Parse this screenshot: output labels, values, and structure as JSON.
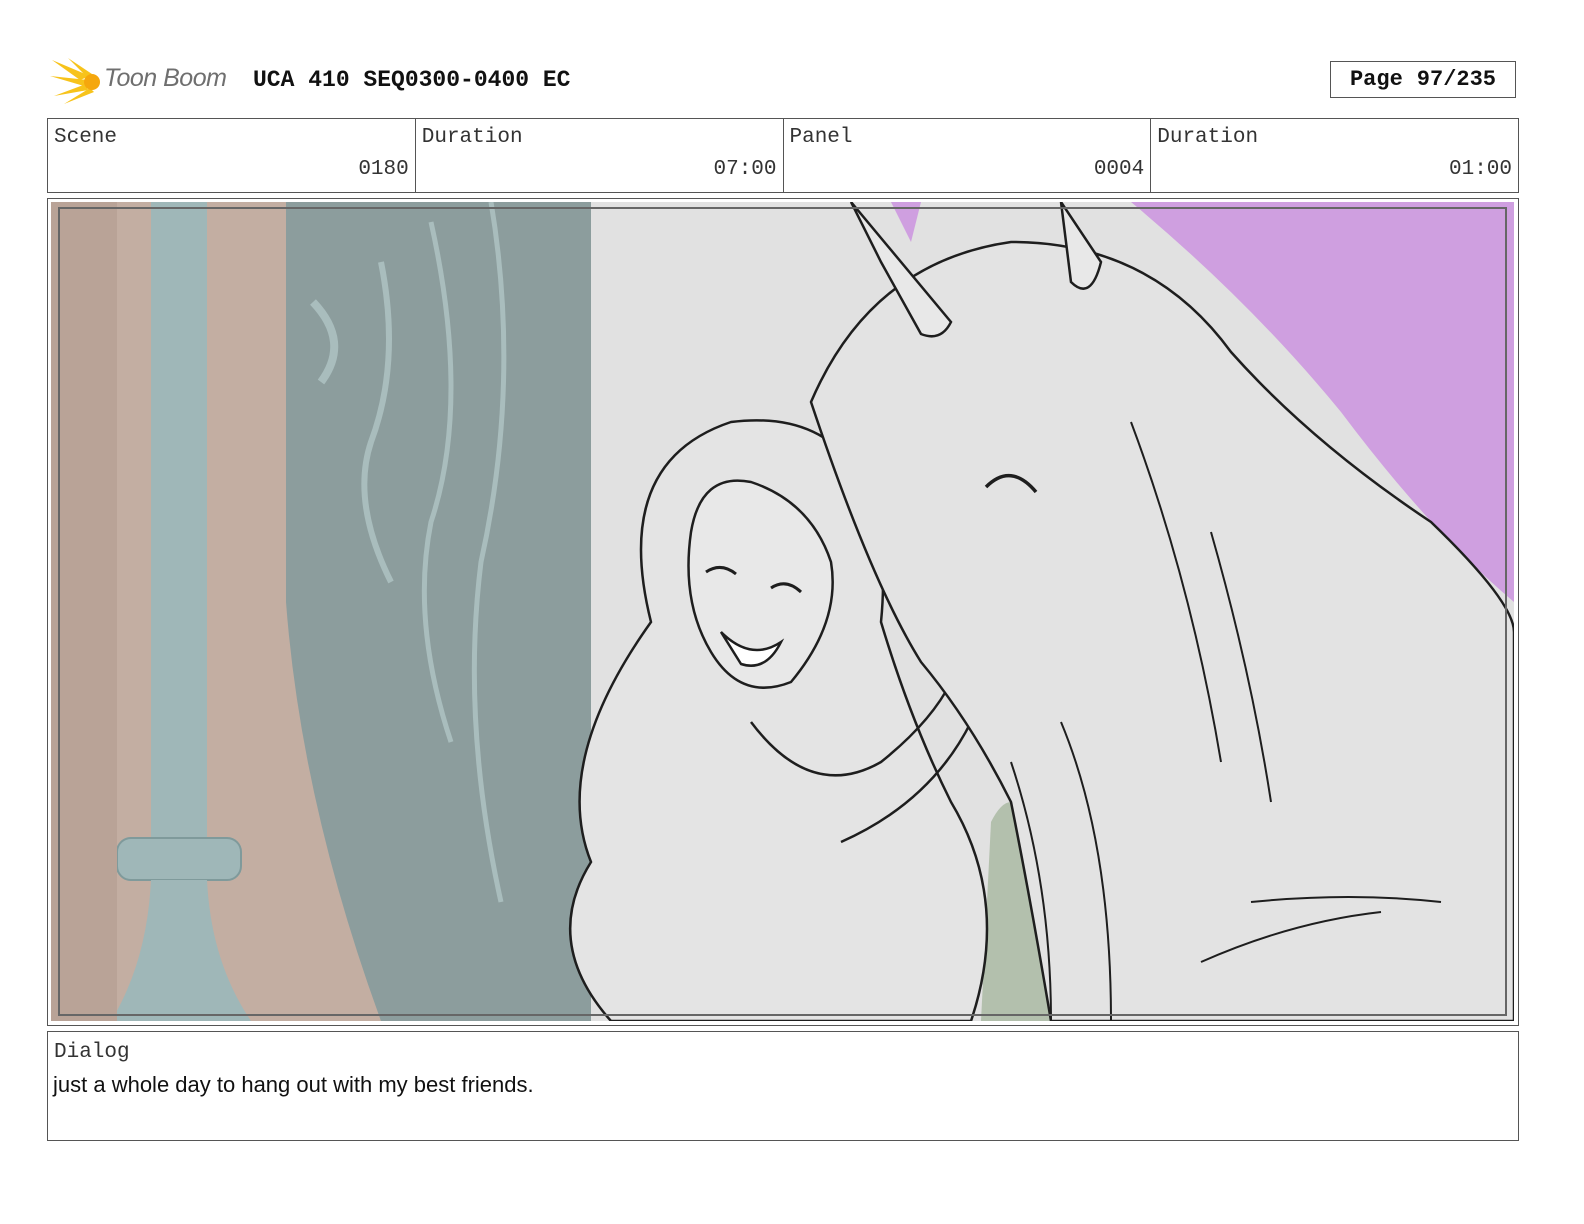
{
  "header": {
    "logo_text": "Toon Boom",
    "project_title": "UCA 410 SEQ0300-0400 EC",
    "page_label": "Page",
    "page_number": "97/235"
  },
  "info": {
    "scene_label": "Scene",
    "scene_value": "0180",
    "scene_duration_label": "Duration",
    "scene_duration_value": "07:00",
    "panel_label": "Panel",
    "panel_value": "0004",
    "panel_duration_label": "Duration",
    "panel_duration_value": "01:00"
  },
  "dialog": {
    "label": "Dialog",
    "text": "just a whole day to hang out with my best friends."
  },
  "colors": {
    "logo_yellow": "#f7c31b",
    "sky_purple": "#cf9fe0",
    "wall_tan": "#c3aea2",
    "pillar_teal": "#9fb7b8",
    "mirror_teal": "#8c9d9d",
    "sketch_gray": "#e4e4e4"
  }
}
